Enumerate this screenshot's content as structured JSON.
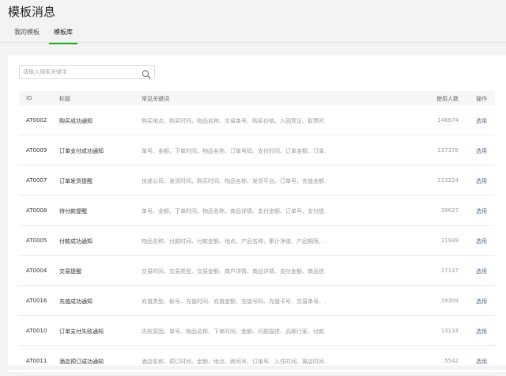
{
  "page": {
    "title": "模板消息"
  },
  "tabs": [
    {
      "label": "我的模板",
      "active": false
    },
    {
      "label": "模板库",
      "active": true
    }
  ],
  "search": {
    "placeholder": "请输入搜索关键字",
    "value": ""
  },
  "table": {
    "columns": {
      "id": "ID",
      "title": "标题",
      "keywords": "常见关键词",
      "users": "使用人数",
      "action": "操作"
    },
    "rows": [
      {
        "id": "AT0002",
        "title": "购买成功通知",
        "keywords": "购买地点、购买时间、物品名称、交易单号、购买价格、入园凭证、取票时...",
        "users": "146674",
        "action": "选用"
      },
      {
        "id": "AT0009",
        "title": "订单支付成功通知",
        "keywords": "单号、金额、下单时间、物品名称、订单号码、支付时间、订单金额、订单...",
        "users": "137378",
        "action": "选用"
      },
      {
        "id": "AT0007",
        "title": "订单发货提醒",
        "keywords": "快递公司、发货时间、购买时间、物品名称、发货平台、订单号、充值金额...",
        "users": "123224",
        "action": "选用"
      },
      {
        "id": "AT0008",
        "title": "待付款提醒",
        "keywords": "单号、金额、下单时间、物品名称、商品详情、支付金额、订单号、支付提...",
        "users": "39627",
        "action": "选用"
      },
      {
        "id": "AT0005",
        "title": "付款成功通知",
        "keywords": "物品名称、付款时间、付款金额、地点、产品名称、累计净值、产品期限、...",
        "users": "31949",
        "action": "选用"
      },
      {
        "id": "AT0004",
        "title": "交易提醒",
        "keywords": "交易时间、交易类型、交易金额、商户详情、商品详情、支付金额、商品信...",
        "users": "27147",
        "action": "选用"
      },
      {
        "id": "AT0016",
        "title": "充值成功通知",
        "keywords": "充值类型、帐号、充值时间、充值金额、充值号码、充值卡号、交易单号、...",
        "users": "19309",
        "action": "选用"
      },
      {
        "id": "AT0010",
        "title": "订单支付失败通知",
        "keywords": "失败原因、单号、物品名称、下单时间、金额、问题描述、品邮行家、付款...",
        "users": "13133",
        "action": "选用"
      },
      {
        "id": "AT0011",
        "title": "酒店预订成功通知",
        "keywords": "酒店名称、预订时间、金额、地点、房间号、订单号、入住时间、离店时间...",
        "users": "5542",
        "action": "选用"
      }
    ]
  },
  "icons": {
    "search": "search-icon"
  },
  "colors": {
    "accent": "#1aad19",
    "link": "#576b95"
  }
}
